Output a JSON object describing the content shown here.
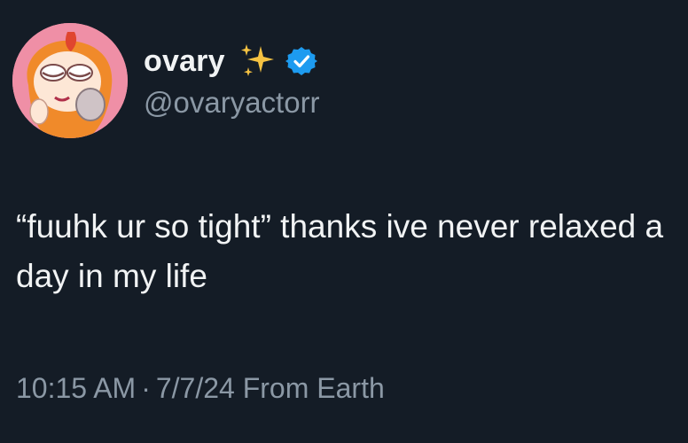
{
  "author": {
    "display_name": "ovary",
    "handle": "@ovaryactorr",
    "name_emoji": "sparkles-icon",
    "verified": true,
    "verified_color": "#1d9bf0",
    "sparkle_color": "#f5c242"
  },
  "tweet": {
    "text": "“fuuhk ur so tight” thanks ive never relaxed a day in my life"
  },
  "meta": {
    "time": "10:15 AM",
    "separator": "·",
    "date": "7/7/24",
    "source": "From Earth"
  },
  "colors": {
    "background": "#141c26",
    "primary_text": "#f1f3f4",
    "secondary_text": "#8b98a5",
    "avatar_bg": "#ef8fa6"
  }
}
